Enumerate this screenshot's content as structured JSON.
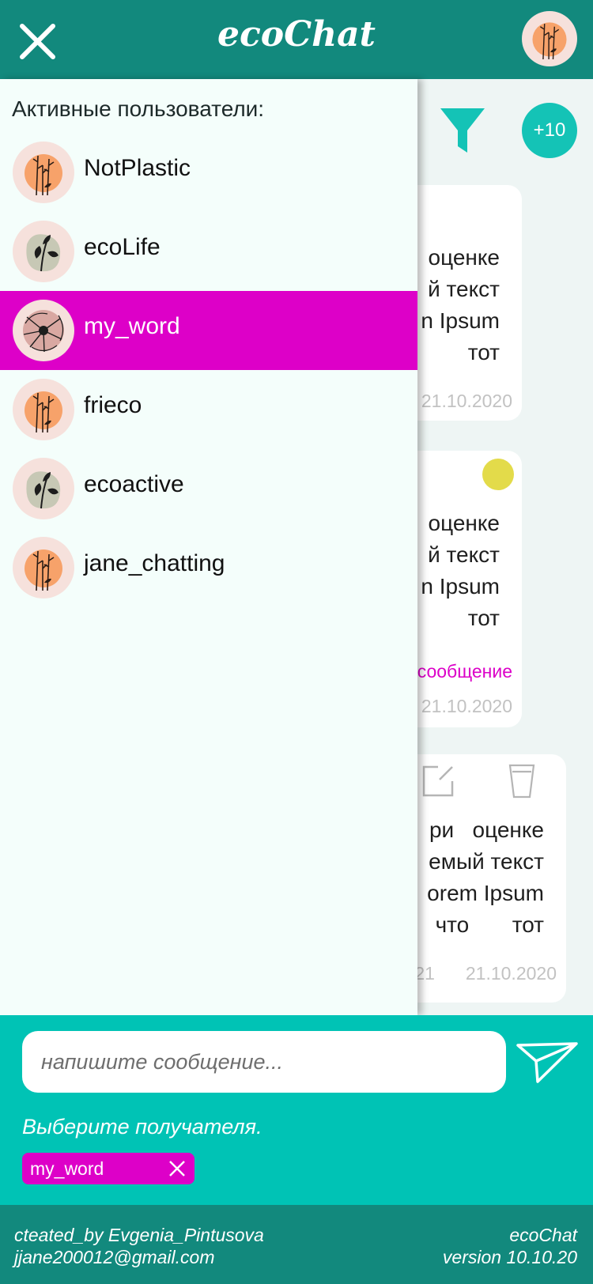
{
  "header": {
    "title": "ecoChat"
  },
  "chat": {
    "participants_badge": "+10",
    "messages": [
      {
        "text_lines": [
          "оценке",
          "й текст",
          "n Ipsum",
          "тот"
        ],
        "date": "21.10.2020"
      },
      {
        "text_lines": [
          "оценке",
          "й текст",
          "n Ipsum",
          "тот"
        ],
        "note": "сообщение",
        "date": "21.10.2020"
      },
      {
        "text_lines": [
          "ри   оценке",
          "емый текст",
          "orem Ipsum",
          "что       тот"
        ],
        "time": ":21",
        "date": "21.10.2020"
      }
    ]
  },
  "drawer": {
    "title": "Активные пользователи:",
    "users": [
      {
        "name": "NotPlastic"
      },
      {
        "name": "ecoLife"
      },
      {
        "name": "my_word"
      },
      {
        "name": "frieco"
      },
      {
        "name": "ecoactive"
      },
      {
        "name": "jane_chatting"
      }
    ]
  },
  "compose": {
    "placeholder": "напишите сообщение...",
    "recipient_hint": "Выберите получателя.",
    "recipient_chip": "my_word"
  },
  "footer": {
    "left_line1": "cteated_by Evgenia_Pintusova",
    "left_line2": "jjane200012@gmail.com",
    "right_line1": "ecoChat",
    "right_line2": "version 10.10.20"
  },
  "colors": {
    "header": "#12897d",
    "accent": "#00c3b5",
    "highlight": "#dd00c8",
    "drawer_bg": "#f4fefb",
    "status_dot": "#e3db4a"
  }
}
